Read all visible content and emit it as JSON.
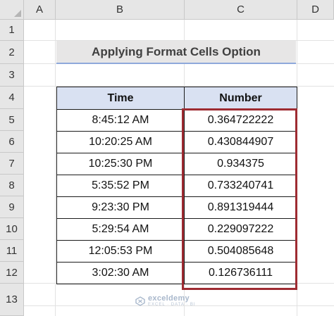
{
  "columns": [
    "A",
    "B",
    "C",
    "D"
  ],
  "rows": [
    "1",
    "2",
    "3",
    "4",
    "5",
    "6",
    "7",
    "8",
    "9",
    "10",
    "11",
    "12",
    "13"
  ],
  "title": "Applying Format Cells Option",
  "table": {
    "headers": [
      "Time",
      "Number"
    ],
    "rows": [
      [
        "8:45:12 AM",
        "0.364722222"
      ],
      [
        "10:20:25 AM",
        "0.430844907"
      ],
      [
        "10:25:30 PM",
        "0.934375"
      ],
      [
        "5:35:52 PM",
        "0.733240741"
      ],
      [
        "9:23:30 PM",
        "0.891319444"
      ],
      [
        "5:29:54 AM",
        "0.229097222"
      ],
      [
        "12:05:53 PM",
        "0.504085648"
      ],
      [
        "3:02:30 AM",
        "0.126736111"
      ]
    ]
  },
  "watermark": {
    "brand": "exceldemy",
    "tagline": "EXCEL · DATA · BI"
  },
  "colors": {
    "header_fill": "#d9e1f2",
    "title_fill": "#e7e6e6",
    "highlight": "#9e2b32",
    "title_underline": "#8ea9db"
  }
}
